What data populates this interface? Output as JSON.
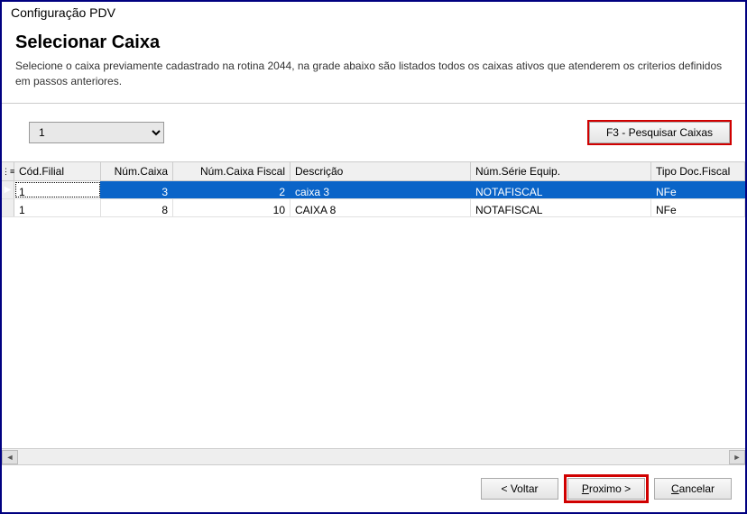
{
  "window": {
    "title": "Configuração PDV"
  },
  "header": {
    "title": "Selecionar Caixa",
    "description": "Selecione o caixa previamente cadastrado na rotina 2044, na grade abaixo são listados todos os caixas ativos que atenderem os criterios definidos em passos anteriores."
  },
  "controls": {
    "filial_selected": "1",
    "search_label": "F3 - Pesquisar Caixas"
  },
  "grid": {
    "indicator_header": "⋮≡",
    "columns": {
      "cod_filial": "Cód.Filial",
      "num_caixa": "Núm.Caixa",
      "num_caixa_fiscal": "Núm.Caixa Fiscal",
      "descricao": "Descrição",
      "num_serie": "Núm.Série Equip.",
      "tipo_doc": "Tipo Doc.Fiscal"
    },
    "rows": [
      {
        "indicator": "▶",
        "selected": true,
        "cod_filial": "1",
        "num_caixa": "3",
        "num_caixa_fiscal": "2",
        "descricao": "caixa 3",
        "num_serie": "NOTAFISCAL",
        "tipo_doc": "NFe"
      },
      {
        "indicator": "",
        "selected": false,
        "cod_filial": "1",
        "num_caixa": "8",
        "num_caixa_fiscal": "10",
        "descricao": "CAIXA 8",
        "num_serie": "NOTAFISCAL",
        "tipo_doc": "NFe"
      }
    ]
  },
  "footer": {
    "back": "< Voltar",
    "next_prefix": "P",
    "next_rest": "roximo >",
    "cancel_prefix": "C",
    "cancel_rest": "ancelar"
  },
  "scroll": {
    "left": "◄",
    "right": "►"
  }
}
